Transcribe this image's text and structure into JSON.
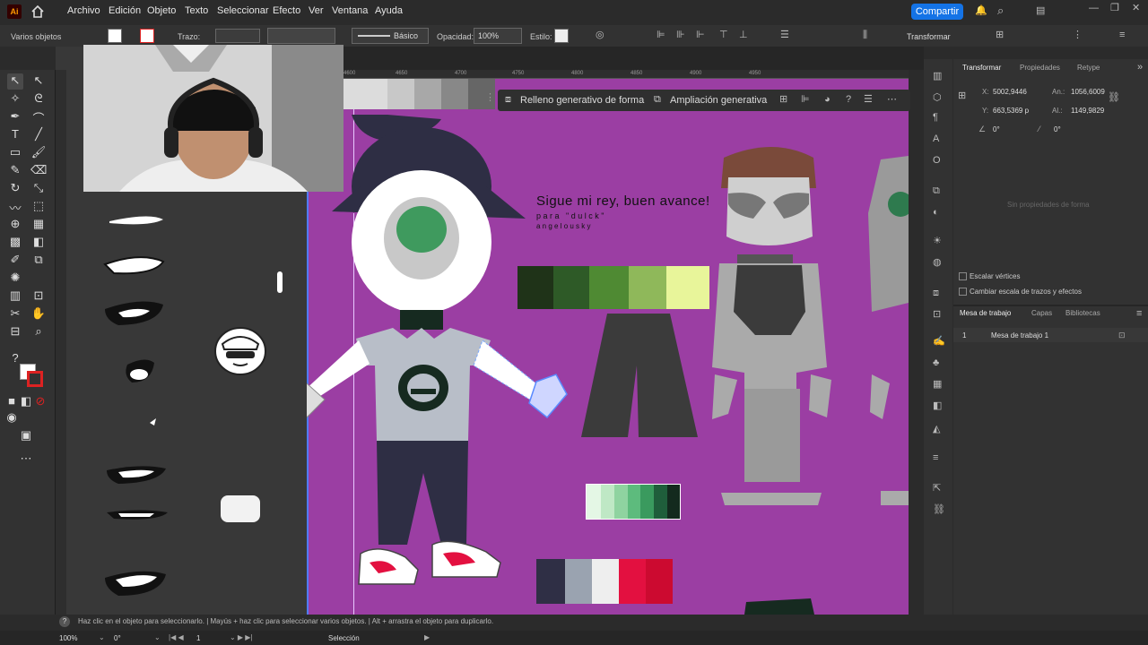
{
  "menubar": {
    "app_icon": "Ai",
    "items": [
      "Archivo",
      "Edición",
      "Objeto",
      "Texto",
      "Seleccionar",
      "Efecto",
      "Ver",
      "Ventana",
      "Ayuda"
    ],
    "share_label": "Compartir"
  },
  "control_bar": {
    "selection": "Varios objetos",
    "stroke_label": "Trazo:",
    "brush_label": "Básico",
    "opacity_label": "Opacidad:",
    "opacity_value": "100%",
    "style_label": "Estilo:",
    "transform_label": "Transformar"
  },
  "ruler": {
    "ticks": [
      "4600",
      "4650",
      "4700",
      "4750",
      "4800",
      "4850",
      "4900",
      "4950"
    ]
  },
  "gen_bar": {
    "fill_label": "Relleno generativo de forma",
    "expand_label": "Ampliación generativa"
  },
  "canvas_text": {
    "line1": "Sigue mi rey, buen avance!",
    "line2": "p a r a   \" d u l c k \"",
    "line3": "a n g e l o u s k y"
  },
  "panel": {
    "tabs": [
      "Transformar",
      "Propiedades",
      "Retype"
    ],
    "x_label": "X:",
    "x_value": "5002,9446",
    "y_label": "Y:",
    "y_value": "663,5369 p",
    "w_label": "An.:",
    "w_value": "1056,6009",
    "h_label": "Al.:",
    "h_value": "1149,9829",
    "rot_value": "0°",
    "shear_value": "0°",
    "no_props": "Sin propiedades de forma",
    "scale_corners": "Escalar vértices",
    "scale_strokes": "Cambiar escala de trazos y efectos",
    "tabs2": [
      "Mesa de trabajo",
      "Capas",
      "Bibliotecas"
    ],
    "artboard_num": "1",
    "artboard_name": "Mesa de trabajo 1"
  },
  "status": {
    "hint": "Haz clic en el objeto para seleccionarlo. | Mayús + haz clic para seleccionar varios objetos. | Alt + arrastra el objeto para duplicarlo.",
    "zoom": "100%",
    "rotation": "0°",
    "artboard": "1",
    "tool": "Selección"
  },
  "colors": {
    "artboard_bg": "#9b3ea3",
    "accent": "#1473e6",
    "greens": [
      "#1f3318",
      "#2e5a27",
      "#4f8a33",
      "#8fb85a",
      "#e8f59a"
    ],
    "mints": [
      "#e4f7e5",
      "#bfe8c5",
      "#8fd3a0",
      "#5dbb7d",
      "#3a9a5e",
      "#1f5e3b",
      "#132a1e"
    ],
    "palette": [
      "#2f2f45",
      "#9aa3b0",
      "#eeeeee",
      "#e31040",
      "#cc0a30"
    ]
  }
}
